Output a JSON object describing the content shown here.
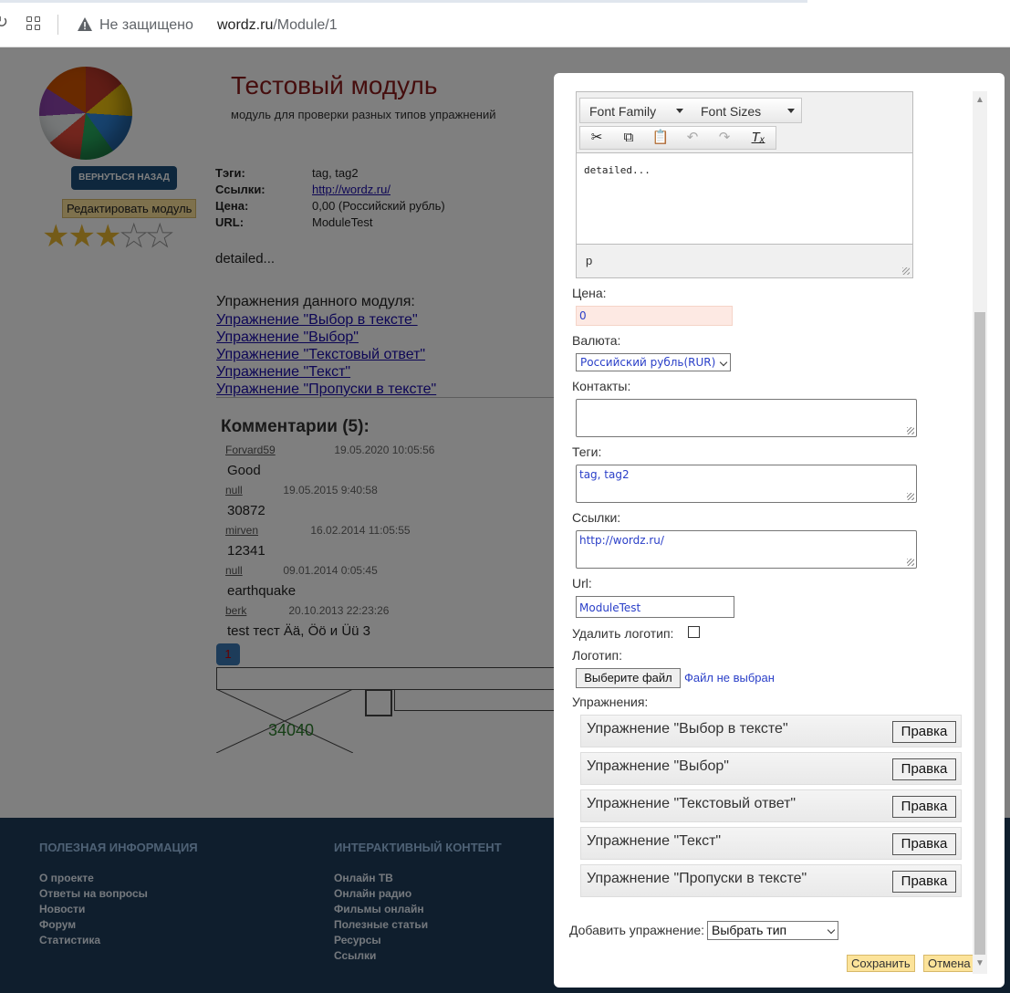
{
  "browser": {
    "security_text": "Не защищено",
    "url_host": "wordz.ru",
    "url_path": "/Module/1"
  },
  "module": {
    "title": "Тестовый модуль",
    "subtitle": "модуль для проверки разных типов упражнений",
    "back_label": "ВЕРНУТЬСЯ НАЗАД",
    "edit_label": "Редактировать модуль",
    "rating": 3,
    "rating_max": 5,
    "info": [
      {
        "key": "Тэги:",
        "value": "tag, tag2"
      },
      {
        "key": "Ссылки:",
        "value": "http://wordz.ru/"
      },
      {
        "key": "Цена:",
        "value": "0,00 (Российский рубль)"
      },
      {
        "key": "URL:",
        "value": "ModuleTest"
      }
    ],
    "detailed": "detailed...",
    "exercises_heading": "Упражнения данного модуля:",
    "exercises": [
      "Упражнение \"Выбор в тексте\"",
      "Упражнение \"Выбор\"",
      "Упражнение \"Текстовый ответ\"",
      "Упражнение \"Текст\"",
      "Упражнение \"Пропуски в тексте\""
    ]
  },
  "comments": {
    "title": "Комментарии (5):",
    "items": [
      {
        "author": "Forvard59",
        "date": "19.05.2020 10:05:56",
        "text": "Good"
      },
      {
        "author": "null",
        "date": "19.05.2015 9:40:58",
        "text": "30872"
      },
      {
        "author": "mirven",
        "date": "16.02.2014 11:05:55",
        "text": "12341"
      },
      {
        "author": "null",
        "date": "09.01.2014 0:05:45",
        "text": "earthquake"
      },
      {
        "author": "berk",
        "date": "20.10.2013 22:23:26",
        "text": "test тест Ää, Öö и Üü 3"
      }
    ],
    "page": "1",
    "counter": "34040"
  },
  "footer": {
    "col1_title": "ПОЛЕЗНАЯ ИНФОРМАЦИЯ",
    "col1_links": [
      "О проекте",
      "Ответы на вопросы",
      "Новости",
      "Форум",
      "Статистика"
    ],
    "col2_title": "ИНТЕРАКТИВНЫЙ КОНТЕНТ",
    "col2_links": [
      "Онлайн ТВ",
      "Онлайн радио",
      "Фильмы онлайн",
      "Полезные статьи",
      "Ресурсы",
      "Ссылки"
    ]
  },
  "modal": {
    "editor": {
      "font_family": "Font Family",
      "font_sizes": "Font Sizes",
      "content": "detailed...",
      "status_path": "p"
    },
    "price_label": "Цена:",
    "price_value": "0",
    "currency_label": "Валюта:",
    "currency_value": "Российский рубль(RUR)",
    "contacts_label": "Контакты:",
    "contacts_value": "",
    "tags_label": "Теги:",
    "tags_value": "tag, tag2",
    "links_label": "Ссылки:",
    "links_value": "http://wordz.ru/",
    "url_label": "Url:",
    "url_value": "ModuleTest",
    "delete_logo_label": "Удалить логотип:",
    "logo_label": "Логотип:",
    "choose_file_label": "Выберите файл",
    "file_status": "Файл не выбран",
    "exercises_label": "Упражнения:",
    "exercises": [
      {
        "name": "Упражнение \"Выбор в тексте\"",
        "edit": "Правка"
      },
      {
        "name": "Упражнение \"Выбор\"",
        "edit": "Правка"
      },
      {
        "name": "Упражнение \"Текстовый ответ\"",
        "edit": "Правка"
      },
      {
        "name": "Упражнение \"Текст\"",
        "edit": "Правка"
      },
      {
        "name": "Упражнение \"Пропуски в тексте\"",
        "edit": "Правка"
      }
    ],
    "add_exercise_label": "Добавить упражнение:",
    "add_exercise_value": "Выбрать тип",
    "save_label": "Сохранить",
    "cancel_label": "Отмена"
  }
}
